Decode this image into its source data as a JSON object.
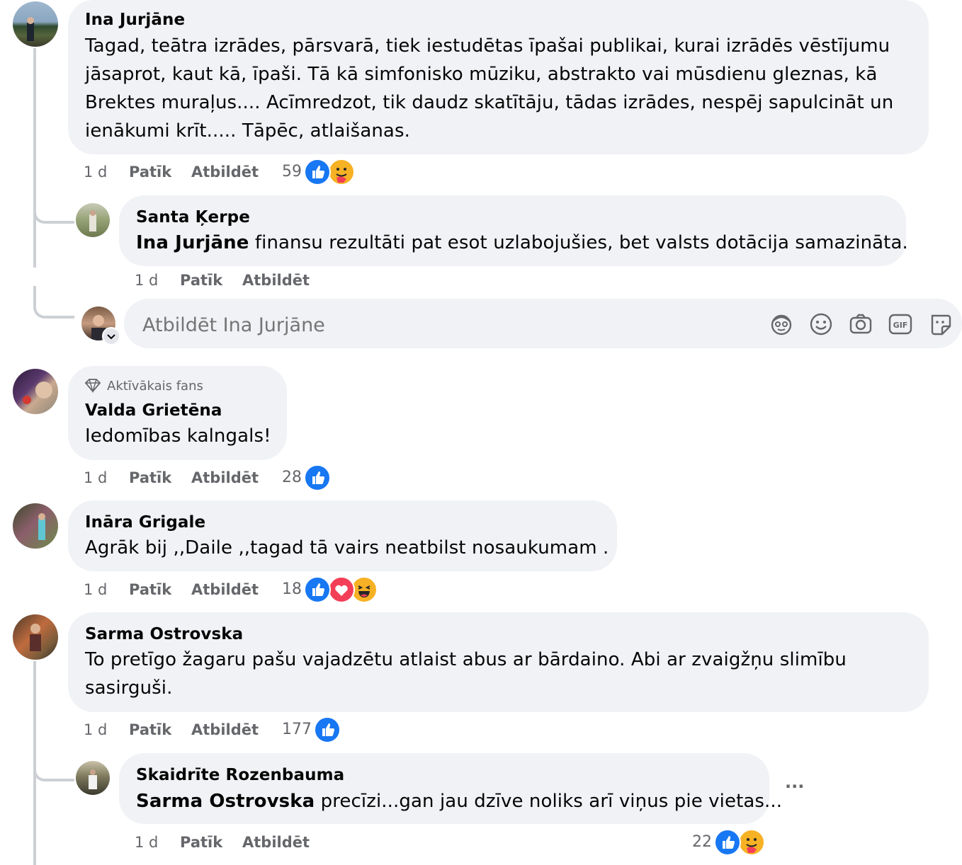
{
  "comments": [
    {
      "author": "Ina Jurjāne",
      "text": "Tagad, teātra izrādes, pārsvarā, tiek iestudētas īpašai publikai, kurai izrādēs vēstījumu jāsaprot, kaut kā, īpaši. Tā kā simfonisko mūziku, abstrakto vai mūsdienu gleznas, kā Brektes muraļus.... Acīmredzot, tik daudz skatītāju, tādas izrādes, nespēj sapulcināt un ienākumi krīt..... Tāpēc, atlaišanas.",
      "time": "1 d",
      "like": "Patīk",
      "reply": "Atbildēt",
      "reaction_count": "59",
      "reactions": [
        "like-icon",
        "care-icon"
      ],
      "replies": [
        {
          "author": "Santa Ķerpe",
          "mention": "Ina Jurjāne",
          "text": " finansu rezultāti pat esot uzlabojušies, bet valsts dotācija samazināta.",
          "time": "1 d",
          "like": "Patīk",
          "reply": "Atbildēt"
        }
      ],
      "reply_box": {
        "placeholder": "Atbildēt Ina Jurjāne"
      }
    },
    {
      "badge": "Aktīvākais fans",
      "author": "Valda Grietēna",
      "text": "Iedomības kalngals!",
      "time": "1 d",
      "like": "Patīk",
      "reply": "Atbildēt",
      "reaction_count": "28",
      "reactions": [
        "like-icon"
      ]
    },
    {
      "author": "Ināra Grigale",
      "text": "Agrāk bij ,,Daile ,,tagad tā vairs neatbilst nosaukumam .",
      "time": "1 d",
      "like": "Patīk",
      "reply": "Atbildēt",
      "reaction_count": "18",
      "reactions": [
        "like-icon",
        "love-icon",
        "haha-icon"
      ]
    },
    {
      "author": "Sarma Ostrovska",
      "text": "To pretīgo žagaru pašu vajadzētu atlaist abus ar bārdaino. Abi ar zvaigžņu slimību sasirguši.",
      "time": "1 d",
      "like": "Patīk",
      "reply": "Atbildēt",
      "reaction_count": "177",
      "reactions": [
        "like-icon"
      ],
      "replies": [
        {
          "author": "Skaidrīte Rozenbauma",
          "mention": "Sarma Ostrovska",
          "text": " precīzi...gan jau dzīve noliks arī viņus pie vietas...",
          "time": "1 d",
          "like": "Patīk",
          "reply": "Atbildēt",
          "reaction_count": "22",
          "reactions": [
            "like-icon",
            "care-icon"
          ],
          "more": "···"
        }
      ]
    }
  ],
  "colors": {
    "bubble": "#f0f2f5",
    "meta_text": "#65676b",
    "like_blue": "#1877f2",
    "love_red": "#f33e58",
    "haha_yellow": "#f7b125",
    "thread_line": "#ccd0d5"
  }
}
